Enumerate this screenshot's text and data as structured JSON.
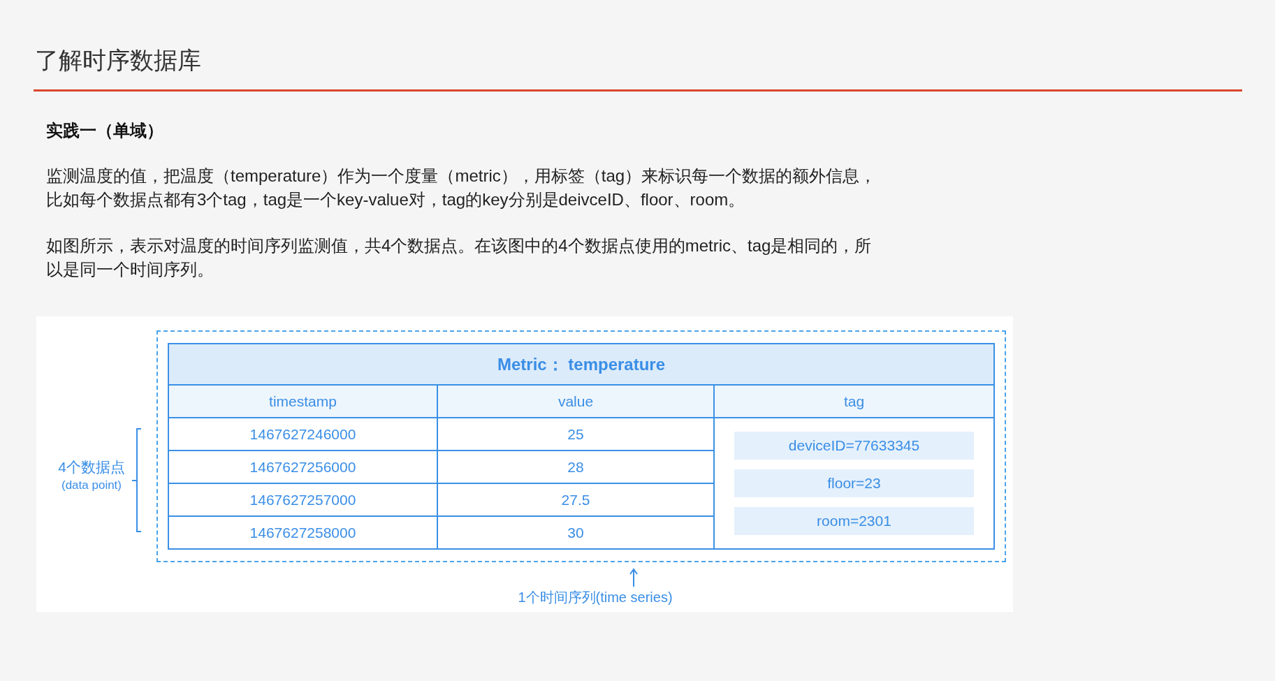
{
  "title": "了解时序数据库",
  "subtitle": "实践一（单域）",
  "paragraphs": [
    [
      "监测温度的值，把温度（temperature）作为一个度量（metric），用标签（tag）来标识每一个数据的额外信息，",
      "比如每个数据点都有3个tag，tag是一个key-value对，tag的key分别是deivceID、floor、room。"
    ],
    [
      "如图所示，表示对温度的时间序列监测值，共4个数据点。在该图中的4个数据点使用的metric、tag是相同的，所",
      "以是同一个时间序列。"
    ]
  ],
  "figure": {
    "points_label": "4个数据点",
    "points_sublabel": "(data point)",
    "metric_title": "Metric： temperature",
    "columns": [
      "timestamp",
      "value",
      "tag"
    ],
    "rows": [
      {
        "timestamp": "1467627246000",
        "value": "25"
      },
      {
        "timestamp": "1467627256000",
        "value": "28"
      },
      {
        "timestamp": "1467627257000",
        "value": "27.5"
      },
      {
        "timestamp": "1467627258000",
        "value": "30"
      }
    ],
    "tags": [
      "deviceID=77633345",
      "floor=23",
      "room=2301"
    ],
    "series_label": "1个时间序列(time series)"
  }
}
